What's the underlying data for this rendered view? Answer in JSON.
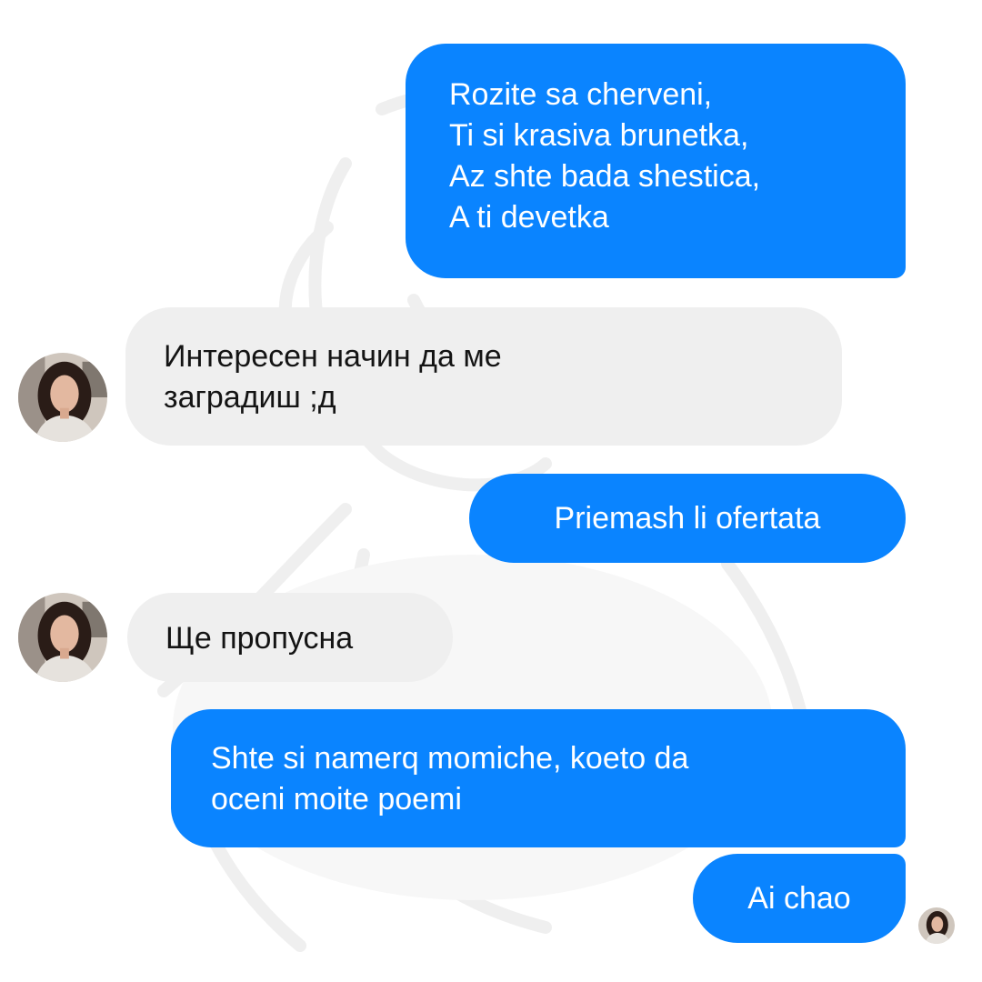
{
  "conversation": {
    "messages": [
      {
        "sender": "me",
        "text": "Rozite sa cherveni,\nTi si krasiva brunetka,\nAz shte bada shestica,\nA ti devetka"
      },
      {
        "sender": "contact",
        "text": "Интересен начин да ме\nзаградиш ;д"
      },
      {
        "sender": "me",
        "text": "Priemash li ofertata"
      },
      {
        "sender": "contact",
        "text": "Ще пропусна"
      },
      {
        "sender": "me",
        "text": "Shte si namerq momiche, koeto da\noceni moite poemi"
      },
      {
        "sender": "me",
        "text": "Ai chao"
      }
    ]
  },
  "colors": {
    "outgoing_bubble": "#0a84ff",
    "incoming_bubble": "#efefef",
    "outgoing_text": "#ffffff",
    "incoming_text": "#141414",
    "background": "#ffffff"
  },
  "icons": {
    "contact_avatar": "contact-avatar-photo",
    "seen_indicator": "seen-avatar-icon",
    "watermark": "faded-cartoon-watermark"
  }
}
